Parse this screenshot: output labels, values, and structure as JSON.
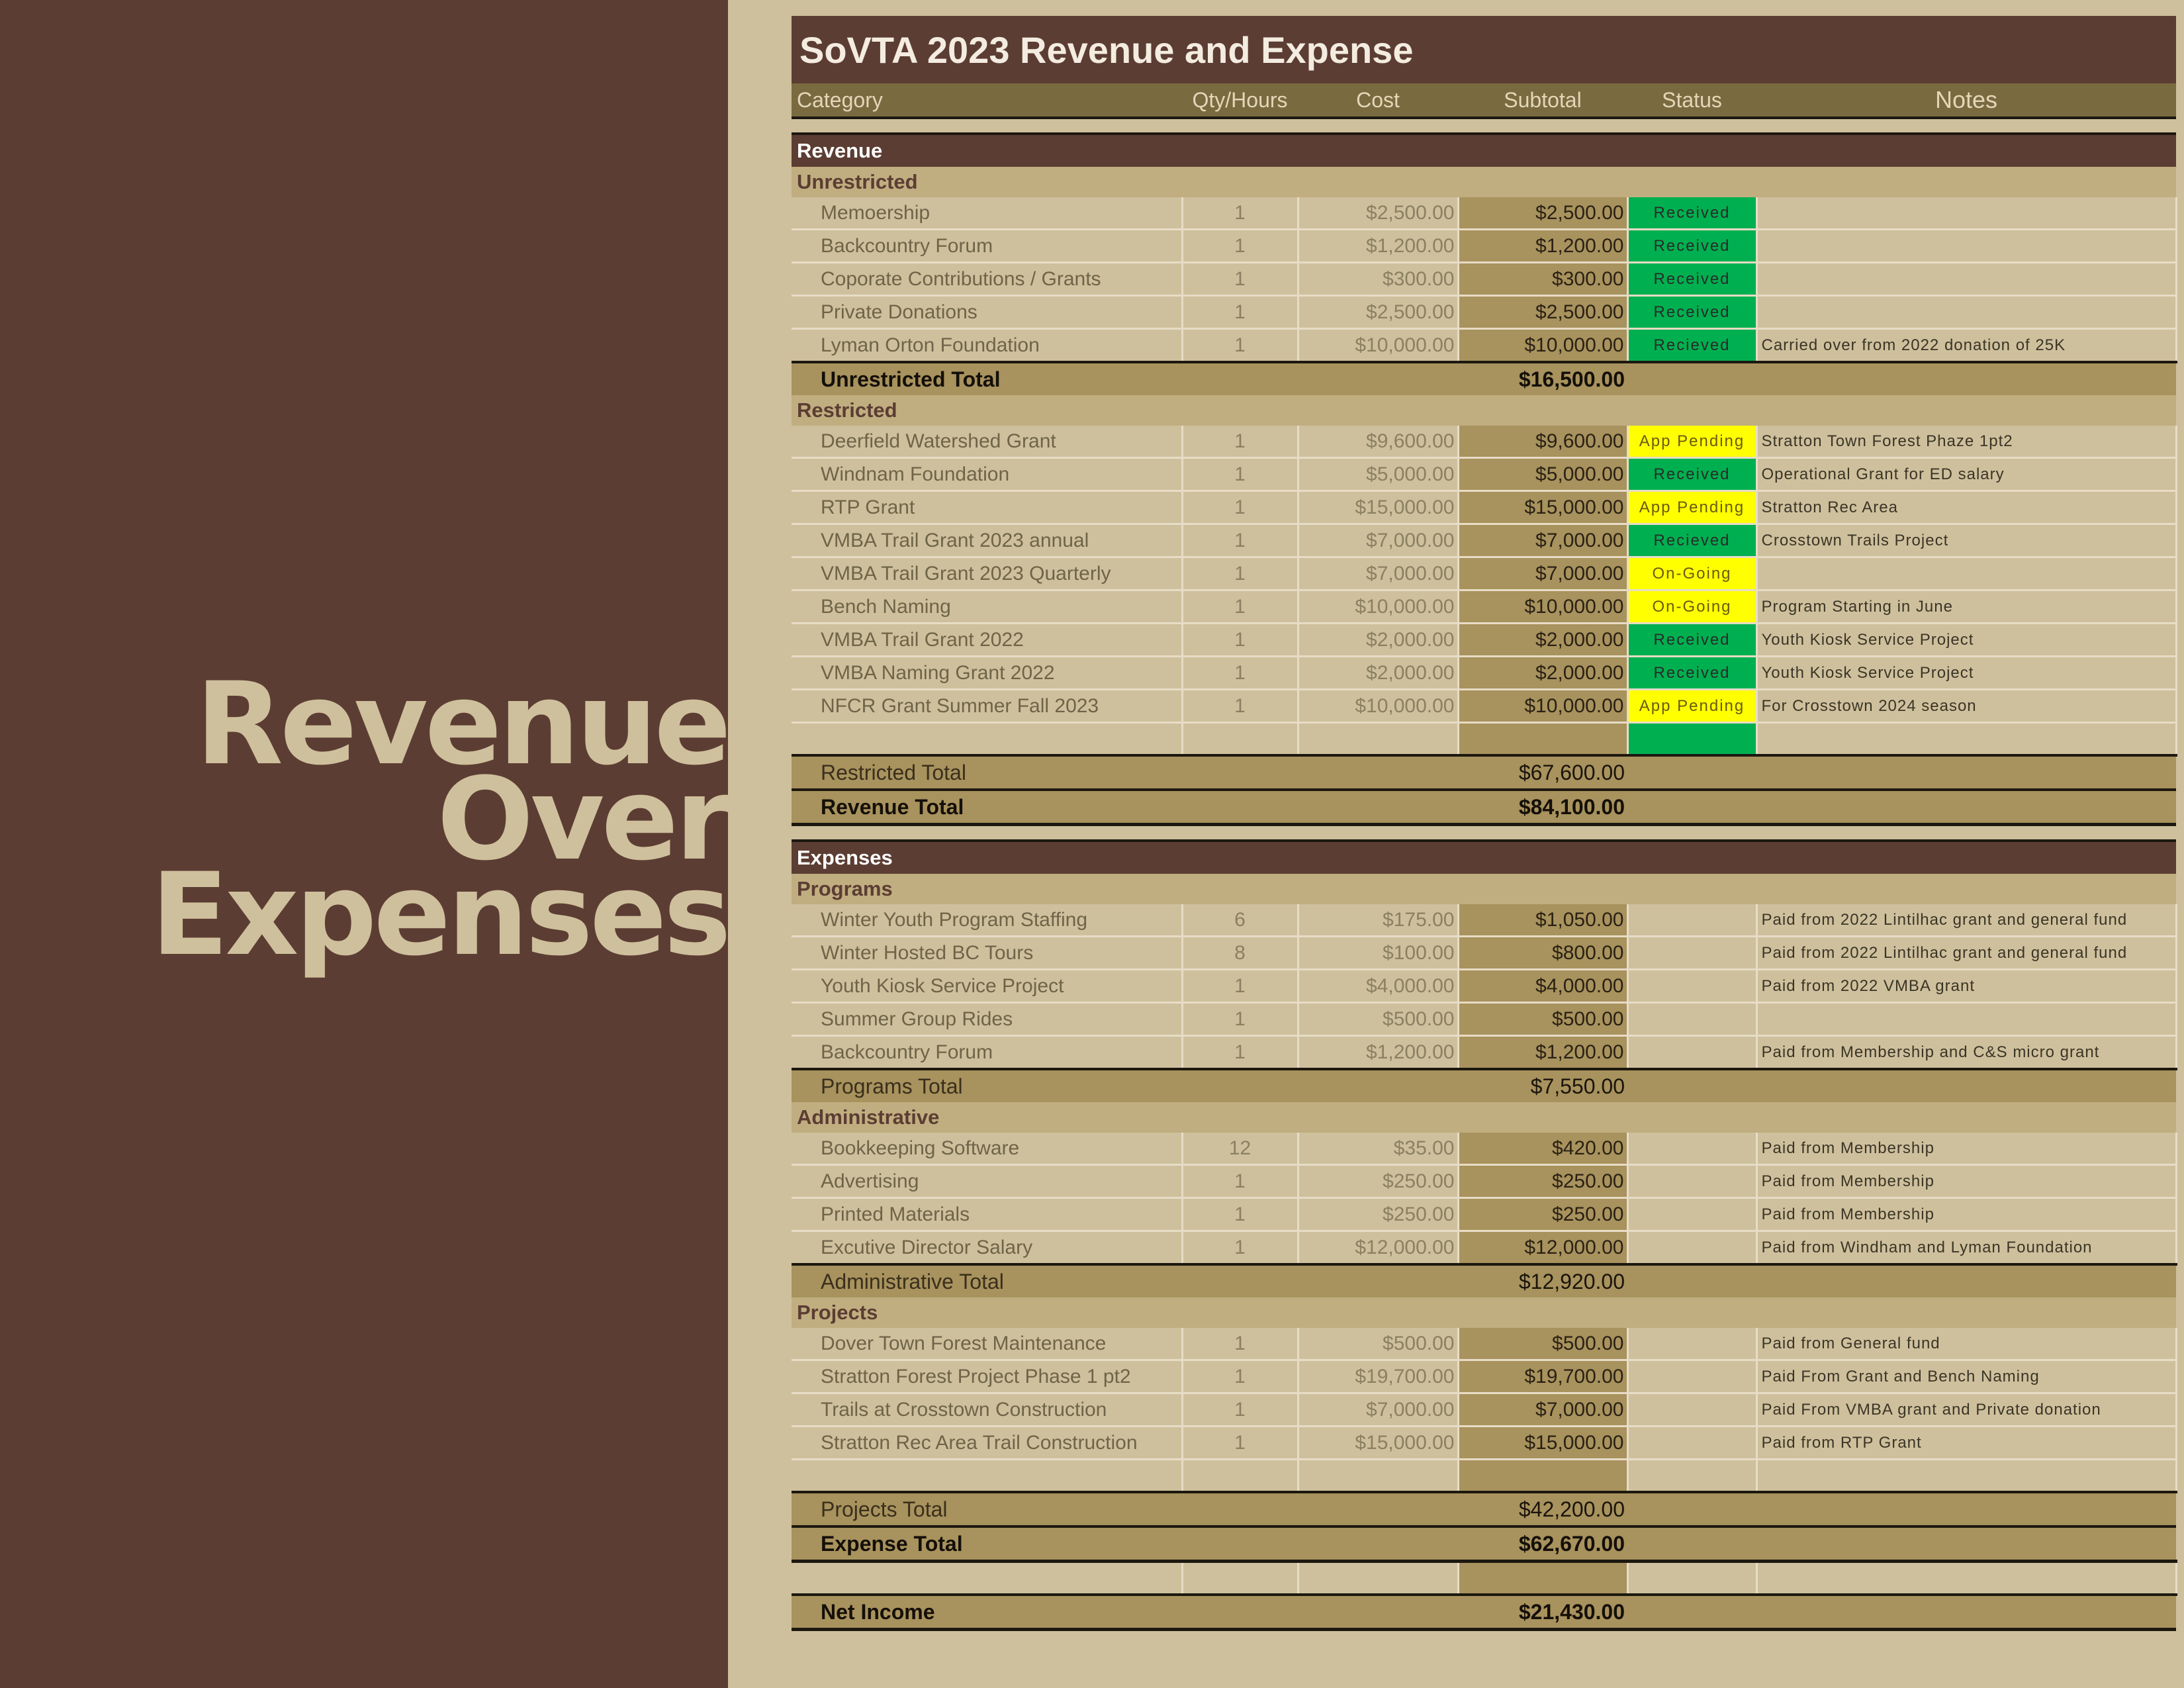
{
  "side_title": [
    "Revenue",
    "Over",
    "Expenses"
  ],
  "sheet": {
    "title": "SoVTA 2023  Revenue and Expense",
    "columns": {
      "category": "Category",
      "qty": "Qty/Hours",
      "cost": "Cost",
      "subtotal": "Subtotal",
      "status": "Status",
      "notes": "Notes"
    }
  },
  "status_colors": {
    "received": "#00b050",
    "pending": "#ffff00"
  },
  "revenue": {
    "label": "Revenue",
    "unrestricted": {
      "label": "Unrestricted",
      "items": [
        {
          "category": "Memoership",
          "qty": "1",
          "cost": "$2,500.00",
          "subtotal": "$2,500.00",
          "status": "Received",
          "status_type": "received",
          "notes": ""
        },
        {
          "category": "Backcountry Forum",
          "qty": "1",
          "cost": "$1,200.00",
          "subtotal": "$1,200.00",
          "status": "Received",
          "status_type": "received",
          "notes": ""
        },
        {
          "category": "Coporate Contributions / Grants",
          "qty": "1",
          "cost": "$300.00",
          "subtotal": "$300.00",
          "status": "Received",
          "status_type": "received",
          "notes": ""
        },
        {
          "category": "Private  Donations",
          "qty": "1",
          "cost": "$2,500.00",
          "subtotal": "$2,500.00",
          "status": "Received",
          "status_type": "received",
          "notes": ""
        },
        {
          "category": "Lyman Orton Foundation",
          "qty": "1",
          "cost": "$10,000.00",
          "subtotal": "$10,000.00",
          "status": "Recieved",
          "status_type": "received",
          "notes": "Carried over from 2022 donation of 25K"
        }
      ],
      "total_label": "Unrestricted Total",
      "total": "$16,500.00"
    },
    "restricted": {
      "label": "Restricted",
      "items": [
        {
          "category": "Deerfield Watershed Grant",
          "qty": "1",
          "cost": "$9,600.00",
          "subtotal": "$9,600.00",
          "status": "App Pending",
          "status_type": "pending",
          "notes": "Stratton Town Forest Phaze 1pt2"
        },
        {
          "category": "Windnam Foundation",
          "qty": "1",
          "cost": "$5,000.00",
          "subtotal": "$5,000.00",
          "status": "Received",
          "status_type": "received",
          "notes": "Operational Grant for ED salary"
        },
        {
          "category": "RTP Grant",
          "qty": "1",
          "cost": "$15,000.00",
          "subtotal": "$15,000.00",
          "status": "App Pending",
          "status_type": "pending",
          "notes": "Stratton Rec Area"
        },
        {
          "category": "VMBA Trail Grant 2023 annual",
          "qty": "1",
          "cost": "$7,000.00",
          "subtotal": "$7,000.00",
          "status": "Recieved",
          "status_type": "received",
          "notes": "Crosstown Trails Project"
        },
        {
          "category": "VMBA Trail Grant 2023 Quarterly",
          "qty": "1",
          "cost": "$7,000.00",
          "subtotal": "$7,000.00",
          "status": "On-Going",
          "status_type": "pending",
          "notes": ""
        },
        {
          "category": "Bench Naming",
          "qty": "1",
          "cost": "$10,000.00",
          "subtotal": "$10,000.00",
          "status": "On-Going",
          "status_type": "pending",
          "notes": "Program Starting in June"
        },
        {
          "category": "VMBA Trail Grant 2022",
          "qty": "1",
          "cost": "$2,000.00",
          "subtotal": "$2,000.00",
          "status": "Received",
          "status_type": "received",
          "notes": "Youth Kiosk Service Project"
        },
        {
          "category": "VMBA Naming Grant 2022",
          "qty": "1",
          "cost": "$2,000.00",
          "subtotal": "$2,000.00",
          "status": "Received",
          "status_type": "received",
          "notes": "Youth Kiosk Service Project"
        },
        {
          "category": "NFCR Grant Summer Fall 2023",
          "qty": "1",
          "cost": "$10,000.00",
          "subtotal": "$10,000.00",
          "status": "App Pending",
          "status_type": "pending",
          "notes": "For Crosstown 2024 season"
        }
      ],
      "total_label": "Restricted Total",
      "total": "$67,600.00"
    },
    "total_label": "Revenue Total",
    "total": "$84,100.00"
  },
  "expenses": {
    "label": "Expenses",
    "programs": {
      "label": "Programs",
      "items": [
        {
          "category": "Winter Youth Program Staffing",
          "qty": "6",
          "cost": "$175.00",
          "subtotal": "$1,050.00",
          "notes": "Paid from 2022 Lintilhac grant and general fund"
        },
        {
          "category": "Winter Hosted BC Tours",
          "qty": "8",
          "cost": "$100.00",
          "subtotal": "$800.00",
          "notes": "Paid from 2022 Lintilhac grant and general fund"
        },
        {
          "category": "Youth Kiosk Service Project",
          "qty": "1",
          "cost": "$4,000.00",
          "subtotal": "$4,000.00",
          "notes": "Paid from 2022 VMBA grant"
        },
        {
          "category": "Summer Group Rides",
          "qty": "1",
          "cost": "$500.00",
          "subtotal": "$500.00",
          "notes": ""
        },
        {
          "category": "Backcountry Forum",
          "qty": "1",
          "cost": "$1,200.00",
          "subtotal": "$1,200.00",
          "notes": "Paid from Membership and C&S micro grant"
        }
      ],
      "total_label": "Programs Total",
      "total": "$7,550.00"
    },
    "administrative": {
      "label": "Administrative",
      "items": [
        {
          "category": "Bookkeeping Software",
          "qty": "12",
          "cost": "$35.00",
          "subtotal": "$420.00",
          "notes": "Paid from Membership"
        },
        {
          "category": "Advertising",
          "qty": "1",
          "cost": "$250.00",
          "subtotal": "$250.00",
          "notes": "Paid from Membership"
        },
        {
          "category": "Printed Materials",
          "qty": "1",
          "cost": "$250.00",
          "subtotal": "$250.00",
          "notes": "Paid from Membership"
        },
        {
          "category": "Excutive Director Salary",
          "qty": "1",
          "cost": "$12,000.00",
          "subtotal": "$12,000.00",
          "notes": "Paid from Windham and Lyman Foundation"
        }
      ],
      "total_label": "Administrative Total",
      "total": "$12,920.00"
    },
    "projects": {
      "label": "Projects",
      "items": [
        {
          "category": "Dover Town Forest Maintenance",
          "qty": "1",
          "cost": "$500.00",
          "subtotal": "$500.00",
          "notes": "Paid from General fund"
        },
        {
          "category": "Stratton Forest Project  Phase 1 pt2",
          "qty": "1",
          "cost": "$19,700.00",
          "subtotal": "$19,700.00",
          "notes": "Paid From Grant and Bench Naming"
        },
        {
          "category": "Trails at Crosstown  Construction",
          "qty": "1",
          "cost": "$7,000.00",
          "subtotal": "$7,000.00",
          "notes": "Paid From VMBA grant and Private donation"
        },
        {
          "category": "Stratton Rec Area Trail Construction",
          "qty": "1",
          "cost": "$15,000.00",
          "subtotal": "$15,000.00",
          "notes": "Paid from RTP Grant"
        }
      ],
      "total_label": "Projects Total",
      "total": "$42,200.00"
    },
    "total_label": "Expense Total",
    "total": "$62,670.00"
  },
  "net_income": {
    "label": "Net Income",
    "value": "$21,430.00"
  }
}
